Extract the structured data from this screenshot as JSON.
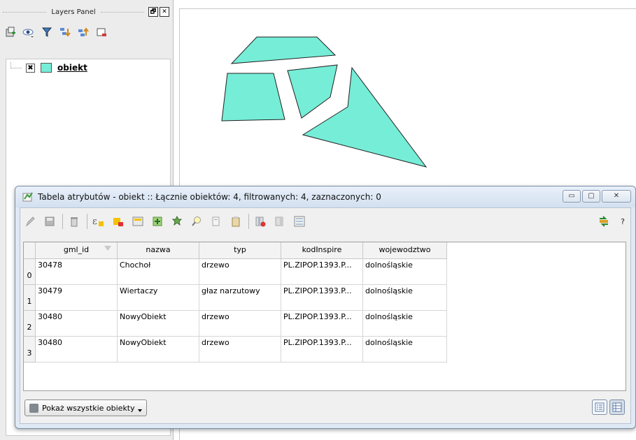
{
  "layers_panel": {
    "title": "Layers Panel",
    "float_button": "🗗",
    "close_button": "✕",
    "toolbar": [
      {
        "icon": "add-group-icon"
      },
      {
        "icon": "eye-icon"
      },
      {
        "icon": "filter-icon"
      },
      {
        "icon": "expand-all-icon"
      },
      {
        "icon": "collapse-all-icon"
      },
      {
        "icon": "remove-layer-icon"
      }
    ],
    "layer": {
      "name": "obiekt",
      "checked_glyph": "✖",
      "swatch_color": "#76edd7"
    }
  },
  "map": {
    "fill_color": "#76edd7",
    "stroke_color": "#1f1f1f"
  },
  "attribute_table": {
    "title": "Tabela atrybutów - obiekt :: Łącznie obiektów: 4, filtrowanych: 4, zaznaczonych: 0",
    "window_controls": {
      "minimize": "▭",
      "maximize": "▢",
      "close": "✕"
    },
    "toolbar_icons": [
      "edit-pencil-icon",
      "save-icon",
      "delete-icon",
      "expression-select-icon",
      "deselect-icon",
      "move-selection-top-icon",
      "invert-selection-icon",
      "pan-to-selected-icon",
      "zoom-to-selected-icon",
      "copy-icon",
      "paste-icon",
      "delete-column-icon",
      "new-column-icon",
      "field-calculator-icon"
    ],
    "help_label": "?",
    "columns": [
      "gml_id",
      "nazwa",
      "typ",
      "kodInspire",
      "wojewodztwo"
    ],
    "rows": [
      {
        "index": "0",
        "cells": [
          "30478",
          "Chochoł",
          "drzewo",
          "PL.ZIPOP.1393.P...",
          "dolnośląskie"
        ]
      },
      {
        "index": "1",
        "cells": [
          "30479",
          "Wiertaczy",
          "głaz narzutowy",
          "PL.ZIPOP.1393.P...",
          "dolnośląskie"
        ]
      },
      {
        "index": "2",
        "cells": [
          "30480",
          "NowyObiekt",
          "drzewo",
          "PL.ZIPOP.1393.P...",
          "dolnośląskie"
        ]
      },
      {
        "index": "3",
        "cells": [
          "30480",
          "NowyObiekt",
          "drzewo",
          "PL.ZIPOP.1393.P...",
          "dolnośląskie"
        ]
      }
    ],
    "show_all_button": "Pokaż wszystkie obiekty"
  }
}
